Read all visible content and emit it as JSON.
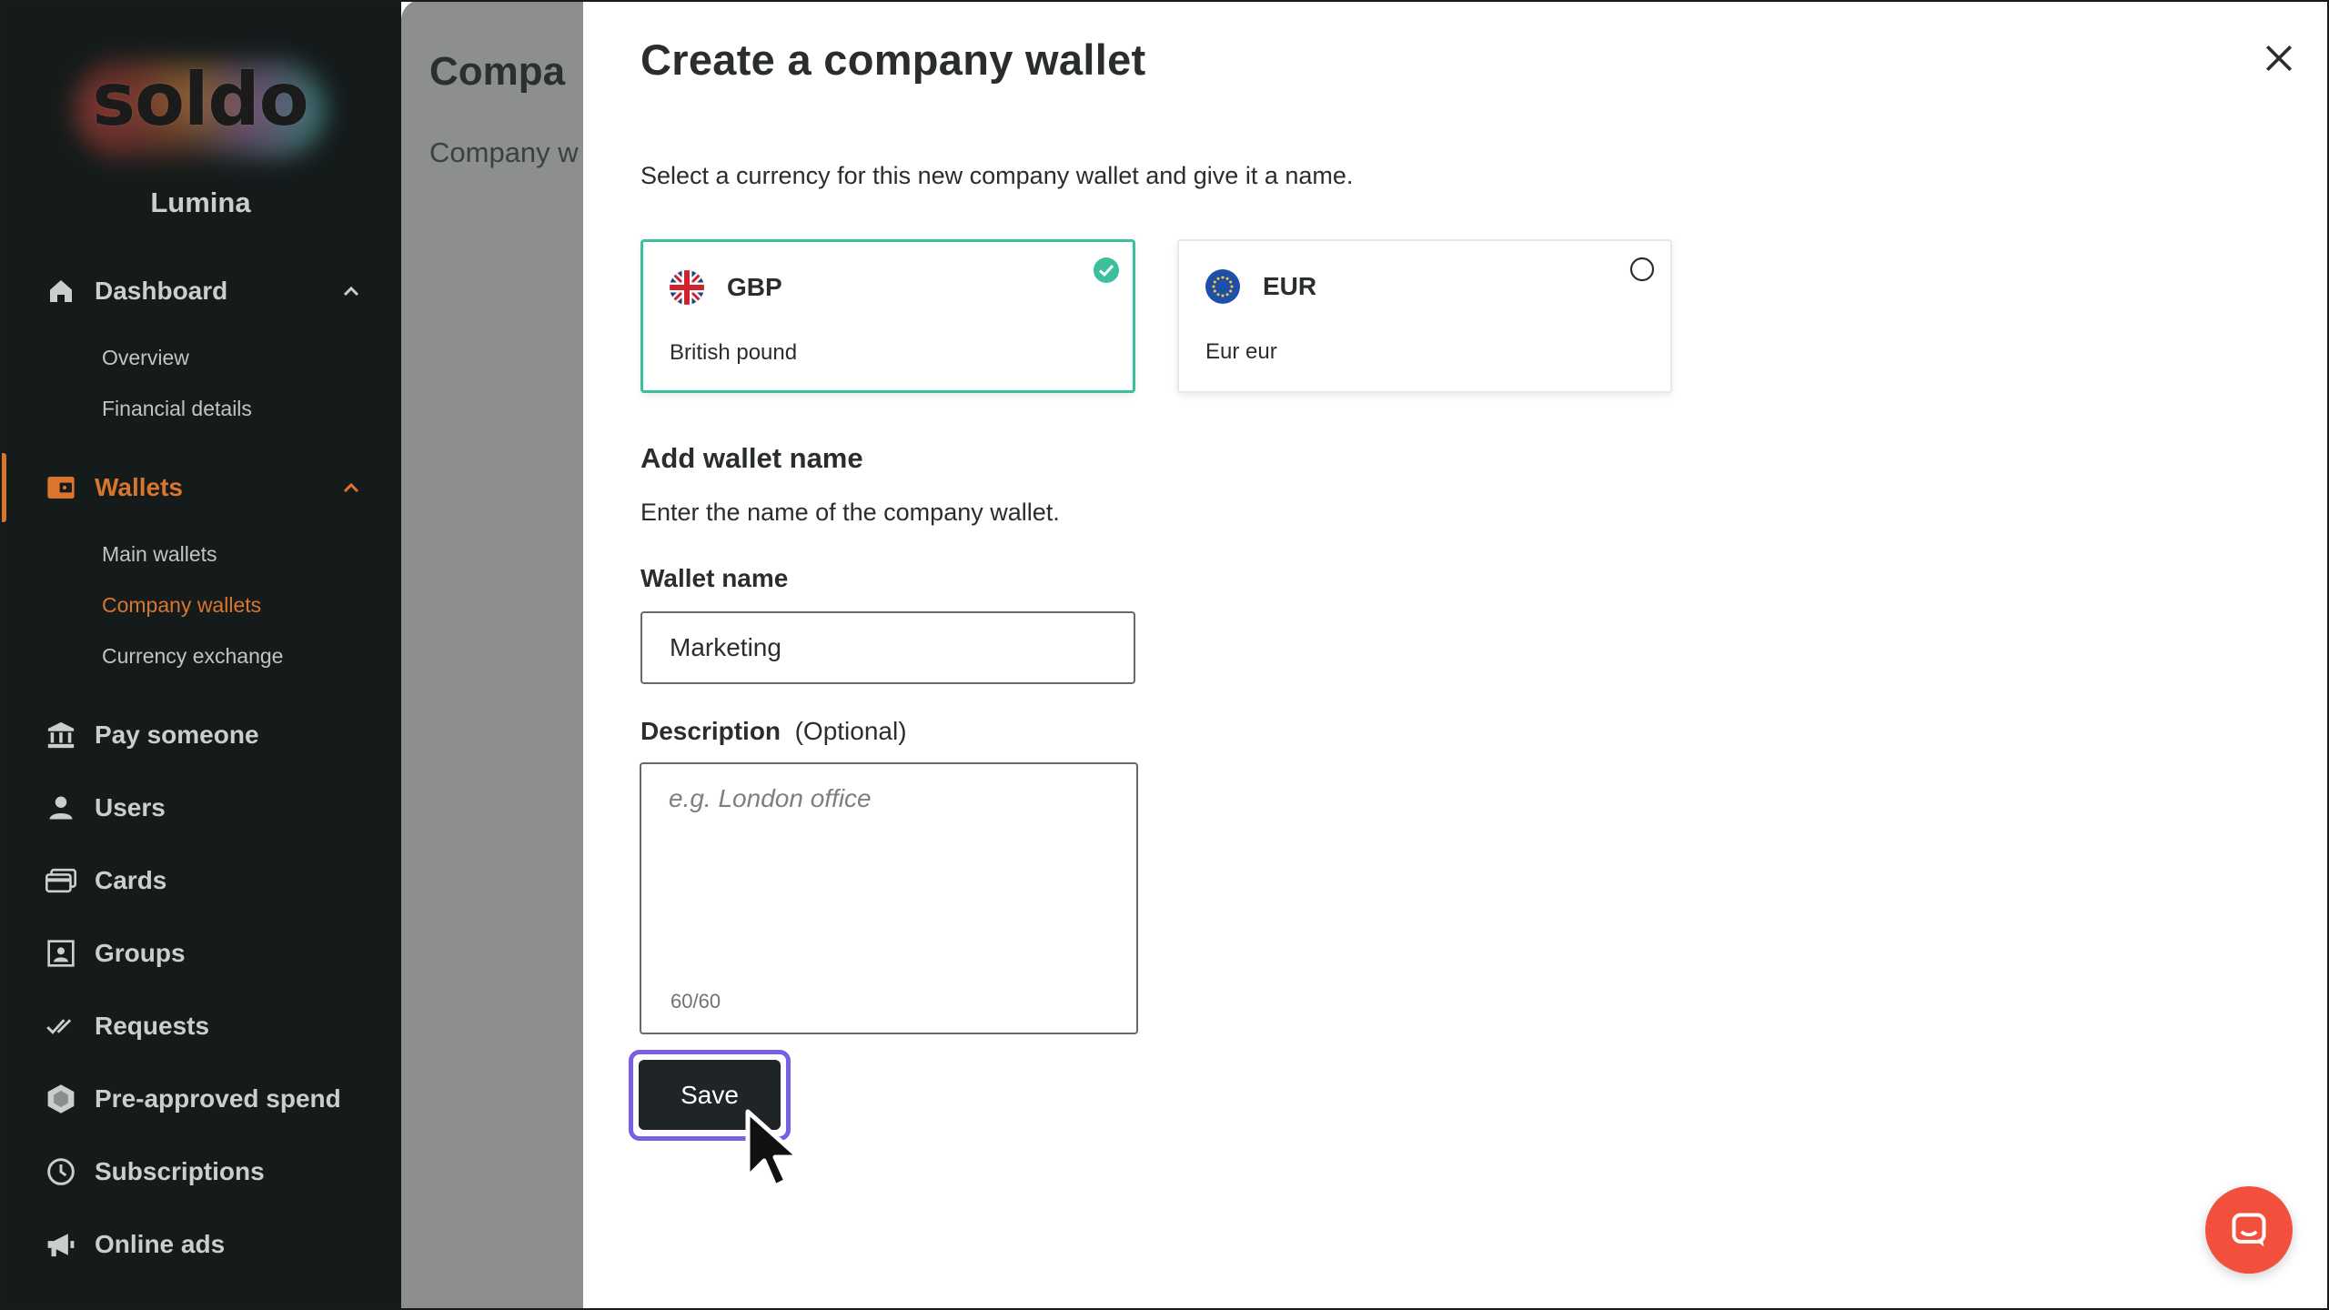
{
  "sidebar": {
    "logo_text": "soldo",
    "org_name": "Lumina",
    "nav": {
      "dashboard": "Dashboard",
      "overview": "Overview",
      "financial_details": "Financial details",
      "wallets": "Wallets",
      "main_wallets": "Main wallets",
      "company_wallets": "Company wallets",
      "currency_exchange": "Currency exchange",
      "pay_someone": "Pay someone",
      "users": "Users",
      "cards": "Cards",
      "groups": "Groups",
      "requests": "Requests",
      "pre_approved_spend": "Pre-approved spend",
      "subscriptions": "Subscriptions",
      "online_ads": "Online ads"
    },
    "active_item": "Company wallets"
  },
  "background_page": {
    "title": "Compa",
    "subtitle": "Company w"
  },
  "modal": {
    "title": "Create a company wallet",
    "intro": "Select a currency for this new company wallet and give it a name.",
    "currencies": [
      {
        "code": "GBP",
        "name": "British pound",
        "selected": true,
        "flag_icon": "uk-flag-icon"
      },
      {
        "code": "EUR",
        "name": "Eur eur",
        "selected": false,
        "flag_icon": "eu-flag-icon"
      }
    ],
    "section_heading": "Add wallet name",
    "section_text": "Enter the name of the company wallet.",
    "wallet_name_label": "Wallet name",
    "wallet_name_value": "Marketing",
    "description_label": "Description",
    "description_optional": "(Optional)",
    "description_placeholder": "e.g. London office",
    "description_counter": "60/60",
    "save_label": "Save"
  },
  "colors": {
    "sidebar_bg": "#151b1b",
    "accent": "#d9752d",
    "selected_border": "#3bbf9c",
    "focus_ring": "#7b5ee6",
    "chat_button": "#f2503c"
  }
}
